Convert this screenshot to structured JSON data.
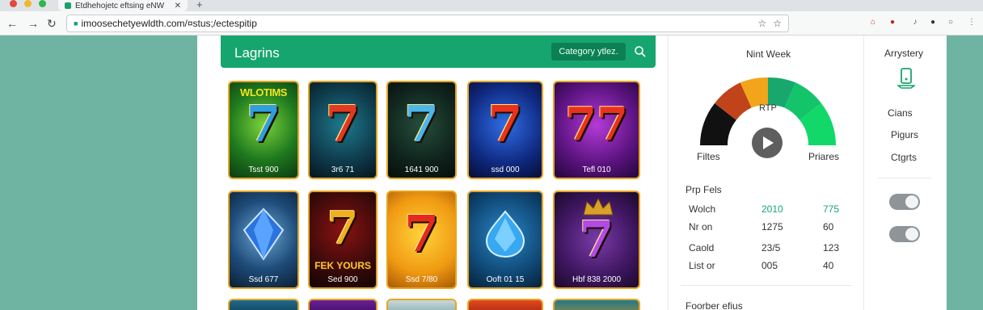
{
  "browser": {
    "tab_title": "Etdhehojetc eftsing eNW",
    "tab_close": "✕",
    "new_tab": "+",
    "url": "imoosechetyewldth.com/¤stus;/ectespitip",
    "back": "←",
    "forward": "→",
    "reload": "↻",
    "zoom_icon": "☆",
    "star_icon": "☆",
    "colors": {
      "tab_red": "#e2483d",
      "tab_yellow": "#f2b630",
      "tab_green": "#2fb54a"
    }
  },
  "header": {
    "brand": "Lagrins",
    "category_button": "Category ytlez."
  },
  "games": [
    {
      "label": "Tsst 900",
      "top_text": "WLOTIMS"
    },
    {
      "label": "3r6 71"
    },
    {
      "label": "1641 900"
    },
    {
      "label": "ssd 000"
    },
    {
      "label": "Tefl 010"
    },
    {
      "label": "Ssd 677"
    },
    {
      "label": "Sed 900",
      "mid_text": "FEK YOURS"
    },
    {
      "label": "Ssd 7/80"
    },
    {
      "label": "Ooft 01 15"
    },
    {
      "label": "Hbf 838 2000"
    }
  ],
  "rtp": {
    "title": "Nint Week",
    "center_label": "RTP",
    "left_label": "Filtes",
    "right_label": "Priares",
    "segment_colors": [
      "#111111",
      "#c0431a",
      "#f2a51a",
      "#18a86e",
      "#14c46a",
      "#12d869"
    ]
  },
  "stats": {
    "title": "Prp Fels",
    "rows": [
      {
        "name": "Wolch",
        "value_a": "2010",
        "value_b": "775"
      },
      {
        "name": "Nr on",
        "value_a": "1275",
        "value_b": "60"
      },
      {
        "name": "Caold",
        "value_a": "23/5",
        "value_b": "123"
      },
      {
        "name": "List or",
        "value_a": "005",
        "value_b": "40"
      }
    ],
    "features_title": "Foorber efius"
  },
  "side": {
    "header": "Arrystery",
    "items": [
      "Cians",
      "Pigurs",
      "Ctgrts"
    ]
  }
}
